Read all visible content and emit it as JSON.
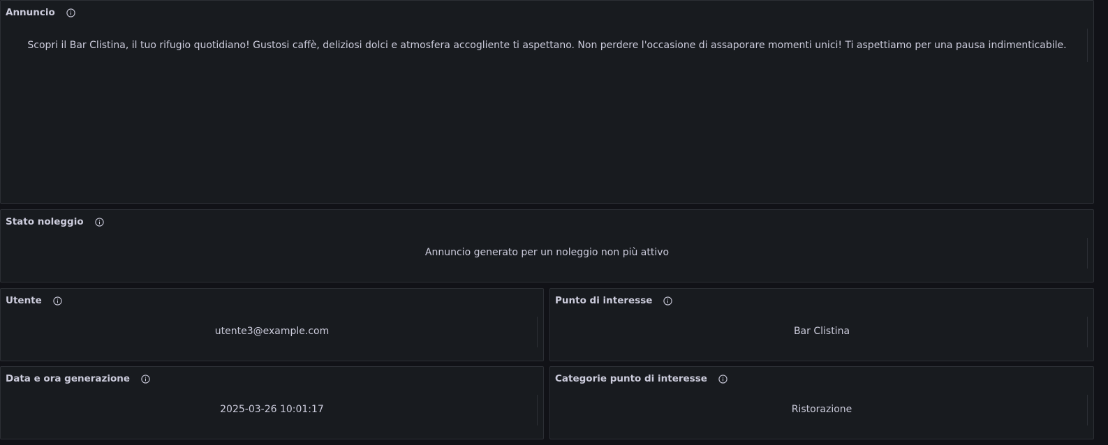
{
  "panels": {
    "annuncio": {
      "title": "Annuncio",
      "value": "Scopri il Bar Clistina, il tuo rifugio quotidiano! Gustosi caffè, deliziosi dolci e atmosfera accogliente ti aspettano. Non perdere l'occasione di assaporare momenti unici! Ti aspettiamo per una pausa indimenticabile."
    },
    "stato_noleggio": {
      "title": "Stato noleggio",
      "value": "Annuncio generato per un noleggio non più attivo"
    },
    "utente": {
      "title": "Utente",
      "value": "utente3@example.com"
    },
    "punto_interesse": {
      "title": "Punto di interesse",
      "value": "Bar Clistina"
    },
    "data_ora": {
      "title": "Data e ora generazione",
      "value": "2025-03-26 10:01:17"
    },
    "categorie": {
      "title": "Categorie punto di interesse",
      "value": "Ristorazione"
    }
  },
  "icons": {
    "panel_info": "info-circle-icon"
  },
  "colors": {
    "background": "#111217",
    "panel": "#181b1f",
    "border": "#2c2f35",
    "text": "#ccccdc"
  }
}
